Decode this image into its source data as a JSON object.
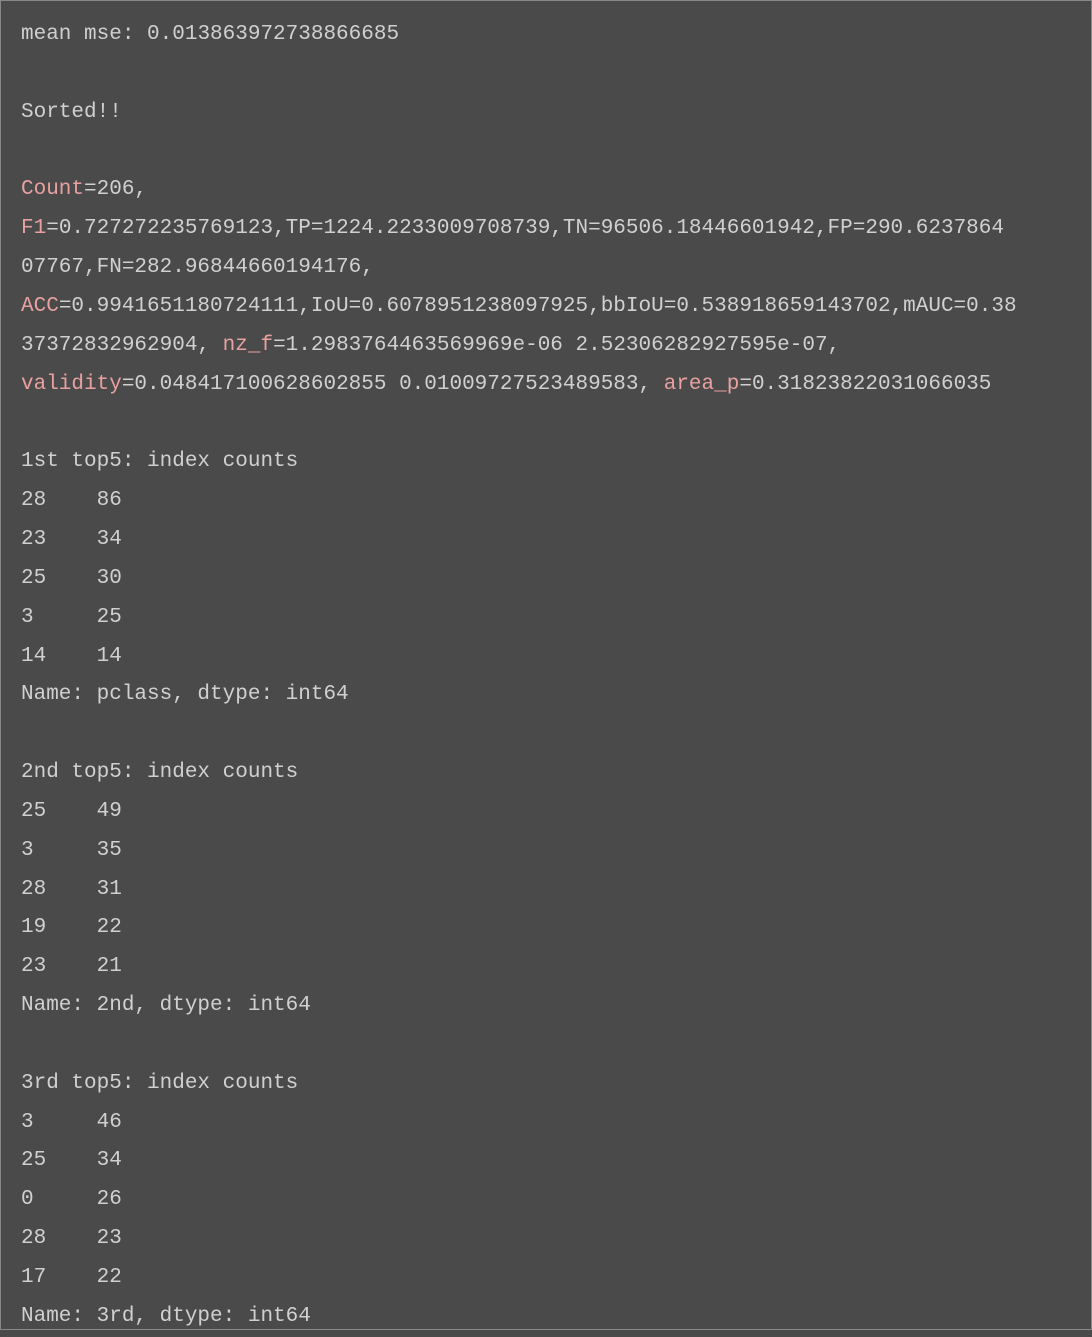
{
  "mean_mse_label": "mean mse: ",
  "mean_mse_value": "0.013863972738866685",
  "sorted_text": "Sorted!!",
  "metrics": {
    "count_label": "Count",
    "count_value": "=206,",
    "f1_label": "F1",
    "f1_line1": "=0.727272235769123,TP=1224.2233009708739,TN=96506.18446601942,FP=290.6237864",
    "f1_line2": "07767,FN=282.96844660194176,",
    "acc_label": "ACC",
    "acc_line1": "=0.9941651180724111,IoU=0.6078951238097925,bbIoU=0.538918659143702,mAUC=0.38",
    "acc_line2a": "37372832962904, ",
    "nzf_label": "nz_f",
    "nzf_value": "=1.2983764463569969e-06 2.52306282927595e-07,",
    "validity_label": "validity",
    "validity_value": "=0.048417100628602855 0.01009727523489583, ",
    "areap_label": "area_p",
    "areap_value": "=0.31823822031066035"
  },
  "top5_1": {
    "header": "1st top5: index counts",
    "rows": [
      {
        "idx": "28",
        "cnt": "86"
      },
      {
        "idx": "23",
        "cnt": "34"
      },
      {
        "idx": "25",
        "cnt": "30"
      },
      {
        "idx": "3",
        "cnt": "25"
      },
      {
        "idx": "14",
        "cnt": "14"
      }
    ],
    "name_line": "Name: pclass, dtype: int64"
  },
  "top5_2": {
    "header": "2nd top5: index counts",
    "rows": [
      {
        "idx": "25",
        "cnt": "49"
      },
      {
        "idx": "3",
        "cnt": "35"
      },
      {
        "idx": "28",
        "cnt": "31"
      },
      {
        "idx": "19",
        "cnt": "22"
      },
      {
        "idx": "23",
        "cnt": "21"
      }
    ],
    "name_line": "Name: 2nd, dtype: int64"
  },
  "top5_3": {
    "header": "3rd top5: index counts",
    "rows": [
      {
        "idx": "3",
        "cnt": "46"
      },
      {
        "idx": "25",
        "cnt": "34"
      },
      {
        "idx": "0",
        "cnt": "26"
      },
      {
        "idx": "28",
        "cnt": "23"
      },
      {
        "idx": "17",
        "cnt": "22"
      }
    ],
    "name_line": "Name: 3rd, dtype: int64"
  }
}
